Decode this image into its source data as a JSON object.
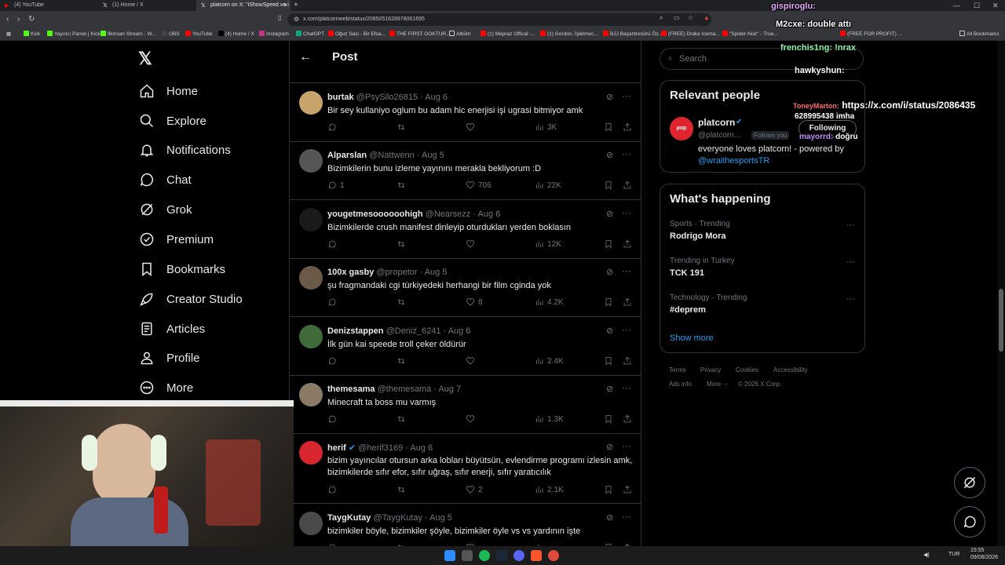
{
  "browser": {
    "tabs": [
      {
        "label": "(4) YouTube"
      },
      {
        "label": "(1) Home / X"
      },
      {
        "label": "platcorn on X: \"iShowSpeed ve i"
      }
    ],
    "url": "x.com/platcornweb/status/2085051628978061695",
    "bookmarks": [
      "Kick",
      "Yayıncı Paneli | Kick",
      "İlkinsan Stream - W...",
      "OBS",
      "YouTube",
      "(4) Home / X",
      "Instagram",
      "ChatGPT",
      "Oğuz Sasi - Bir Efsa...",
      "THE FIRST GOKTUR...",
      "Albüm",
      "(1) Mepraz Offical -...",
      "(1) Gordon, İşletmec...",
      "BJJ Başantrenörü Öz...",
      "(FREE) Drake Icema...",
      "\"Spider-Noir\" - True...",
      "(FREE FOR PROFIT) ..."
    ],
    "all_bookmarks": "All Bookmarks"
  },
  "nav": {
    "items": [
      {
        "label": "Home"
      },
      {
        "label": "Explore"
      },
      {
        "label": "Notifications"
      },
      {
        "label": "Chat"
      },
      {
        "label": "Grok"
      },
      {
        "label": "Premium"
      },
      {
        "label": "Bookmarks"
      },
      {
        "label": "Creator Studio"
      },
      {
        "label": "Articles"
      },
      {
        "label": "Profile"
      },
      {
        "label": "More"
      }
    ]
  },
  "post": {
    "title": "Post",
    "replies": [
      {
        "name": "burtak",
        "handle": "@PsySilo26815 · Aug 6",
        "text": "Bir sey kullaniyo oglum bu adam hic enerjisi işi ugrasi bitmiyor amk",
        "replies": "",
        "likes": "",
        "views": "3K",
        "avatar_color": "#c9a46a"
      },
      {
        "name": "Alparslan",
        "handle": "@Nattwenn · Aug 5",
        "text": "Bizimkilerin bunu izleme yayınını merakla bekliyorum :D",
        "replies": "1",
        "likes": "706",
        "views": "22K",
        "avatar_color": "#555555"
      },
      {
        "name": "yougetmesoooooohigh",
        "handle": "@Nearsezz · Aug 6",
        "text": "Bizimkilerde crush manifest dinleyip oturdukları yerden boklasın",
        "replies": "",
        "likes": "",
        "views": "12K",
        "avatar_color": "#1a1a1a"
      },
      {
        "name": "100x gasby",
        "handle": "@propetor · Aug 5",
        "text": "şu fragmandaki cgi türkiyedeki herhangi bir film cginda yok",
        "replies": "",
        "likes": "8",
        "views": "4.2K",
        "avatar_color": "#6b5a48"
      },
      {
        "name": "Denizstappen",
        "handle": "@Deniz_6241 · Aug 6",
        "text": "İlk gün kai speede troll çeker öldürür",
        "replies": "",
        "likes": "",
        "views": "2.4K",
        "avatar_color": "#3f6b3a"
      },
      {
        "name": "themesama",
        "handle": "@themesama · Aug 7",
        "text": "Minecraft ta boss mu varmış",
        "replies": "",
        "likes": "",
        "views": "1.3K",
        "avatar_color": "#8a7a66"
      },
      {
        "name": "herif",
        "handle": "@herif3169 · Aug 6",
        "text": "bizim yayıncılar otursun arka lobları büyütsün, evlendirme programı izlesin amk, bizimkilerde sıfır efor, sıfır uğraş, sıfır enerji, sıfır yaratıcılık",
        "replies": "",
        "likes": "2",
        "views": "2.1K",
        "avatar_color": "#d8262f"
      },
      {
        "name": "TaygKutay",
        "handle": "@TaygKutay · Aug 5",
        "text": "bizimkiler böyle, bizimkiler şöyle, bizimkiler öyle vs vs yardının işte",
        "replies": "",
        "likes": "",
        "views": "",
        "avatar_color": "#4a4a4a"
      }
    ]
  },
  "right": {
    "search_placeholder": "Search",
    "relevant_title": "Relevant people",
    "person_name": "platcorn",
    "person_handle": "@platcorn...",
    "person_follows": "Follows you",
    "person_button": "Following",
    "person_bio": "everyone loves platcorn! - powered by",
    "person_bio_link": "@wraithesportsTR",
    "happening_title": "What's happening",
    "trends": [
      {
        "cat": "Sports · Trending",
        "name": "Rodrigo Mora"
      },
      {
        "cat": "Trending in Turkey",
        "name": "TCK 191"
      },
      {
        "cat": "Technology · Trending",
        "name": "#deprem"
      }
    ],
    "show_more": "Show more",
    "footer_1": [
      "Terms",
      "Privacy",
      "Cookies",
      "Accessibility"
    ],
    "footer_2": [
      "Ads info",
      "More ···",
      "© 2026 X Corp."
    ]
  },
  "overlay_chat": [
    {
      "user": "gispiroglu:",
      "msg": ""
    },
    {
      "user": "M2cxe:",
      "msg": "double attı"
    },
    {
      "user": "frenchis1ng:",
      "msg": "!nrax"
    },
    {
      "user": "hawkyshun:",
      "msg": ""
    },
    {
      "user": "ToneyMarton:",
      "msg": "https://x.com/i/status/2086435"
    },
    {
      "user": "",
      "msg": "628995438 imha"
    },
    {
      "user": "mayorrd:",
      "msg": "doğru"
    }
  ],
  "taskbar": {
    "lang": "TUR",
    "time": "15:55",
    "date": "09/08/2026"
  }
}
